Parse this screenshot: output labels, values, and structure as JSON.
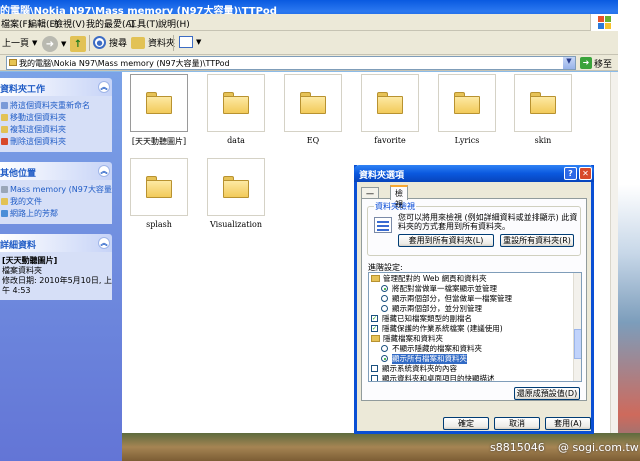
{
  "window": {
    "title": "的電腦\\Nokia N97\\Mass memory (N97大容量)\\TTPod",
    "menu": [
      "檔案(F)",
      "編輯(E)",
      "檢視(V)",
      "我的最愛(A)",
      "工具(T)",
      "說明(H)"
    ]
  },
  "toolbar": {
    "back": "上一頁",
    "search": "搜尋",
    "folders": "資料夾"
  },
  "address": {
    "path": "我的電腦\\Nokia N97\\Mass memory (N97大容量)\\TTPod",
    "go": "移至"
  },
  "taskpane": {
    "file_tasks": {
      "title": "資料夾工作",
      "links": [
        "將這個資料夾重新命名",
        "移動這個資料夾",
        "複製這個資料夾",
        "刪除這個資料夾"
      ]
    },
    "other_places": {
      "title": "其他位置",
      "links": [
        "Mass memory (N97大容量)",
        "我的文件",
        "網路上的芳鄰"
      ]
    },
    "details": {
      "title": "詳細資料",
      "name": "[天天動聽圖片]",
      "type": "檔案資料夾",
      "modified": "修改日期: 2010年5月10日, 上午 4:53"
    }
  },
  "folders": [
    {
      "name": "[天天動聽圖片]",
      "selected": true
    },
    {
      "name": "data",
      "selected": false
    },
    {
      "name": "EQ",
      "selected": false
    },
    {
      "name": "favorite",
      "selected": false
    },
    {
      "name": "Lyrics",
      "selected": false
    },
    {
      "name": "skin",
      "selected": false
    },
    {
      "name": "splash",
      "selected": false
    },
    {
      "name": "Visualization",
      "selected": false
    }
  ],
  "dialog": {
    "title": "資料夾選項",
    "tabs": [
      "一般",
      "檢視"
    ],
    "active_tab": "檢視",
    "group_title": "資料夾檢視",
    "group_desc": "您可以將用來檢視 (例如詳細資料或並排顯示) 此資料夾的方式套用到所有資料夾。",
    "apply_all": "套用到所有資料夾(L)",
    "reset_all": "重設所有資料夾(R)",
    "advanced_label": "進階設定:",
    "tree": [
      {
        "kind": "folder",
        "indent": 0,
        "text": "管理配對的 Web 網頁和資料夾"
      },
      {
        "kind": "radio",
        "on": true,
        "indent": 1,
        "text": "將配對當做單一檔案顯示並管理"
      },
      {
        "kind": "radio",
        "on": false,
        "indent": 1,
        "text": "顯示兩個部分，但當做單一檔案管理"
      },
      {
        "kind": "radio",
        "on": false,
        "indent": 1,
        "text": "顯示兩個部分，並分別管理"
      },
      {
        "kind": "check",
        "on": true,
        "indent": 0,
        "text": "隱藏已知檔案類型的副檔名"
      },
      {
        "kind": "check",
        "on": true,
        "indent": 0,
        "text": "隱藏保護的作業系統檔案 (建議使用)"
      },
      {
        "kind": "folder",
        "indent": 0,
        "text": "隱藏檔案和資料夾"
      },
      {
        "kind": "radio",
        "on": false,
        "indent": 1,
        "text": "不顯示隱藏的檔案和資料夾"
      },
      {
        "kind": "radio",
        "on": true,
        "indent": 1,
        "text": "顯示所有檔案和資料夾",
        "selected": true
      },
      {
        "kind": "check",
        "on": false,
        "indent": 0,
        "text": "顯示系統資料夾的內容"
      },
      {
        "kind": "check",
        "on": false,
        "indent": 0,
        "text": "顯示資料夾和桌面項目的快顯描述"
      }
    ],
    "restore_defaults": "還原成預設值(D)",
    "ok": "確定",
    "cancel": "取消",
    "apply": "套用(A)"
  },
  "watermark": {
    "left": "s8815046",
    "right": "@ sogi.com.tw"
  }
}
